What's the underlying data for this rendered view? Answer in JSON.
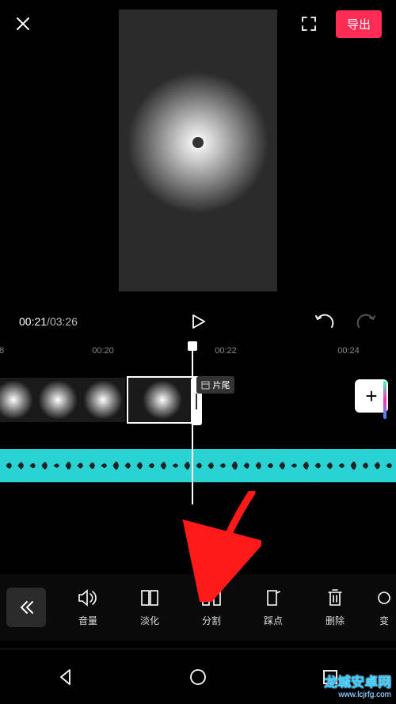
{
  "header": {
    "export_label": "导出"
  },
  "playback": {
    "current": "00:21",
    "total": "03:26"
  },
  "ruler": {
    "t0": "8",
    "t1": "00:20",
    "t2": "00:22",
    "t3": "00:24"
  },
  "timeline": {
    "end_label": "片尾"
  },
  "tools": [
    {
      "id": "volume",
      "label": "音量"
    },
    {
      "id": "fade",
      "label": "淡化"
    },
    {
      "id": "split",
      "label": "分割"
    },
    {
      "id": "beat",
      "label": "踩点"
    },
    {
      "id": "delete",
      "label": "删除"
    },
    {
      "id": "change",
      "label": "变"
    }
  ],
  "watermark": {
    "line1": "龙城安卓网",
    "line2": "www.lcjrfg.com"
  }
}
